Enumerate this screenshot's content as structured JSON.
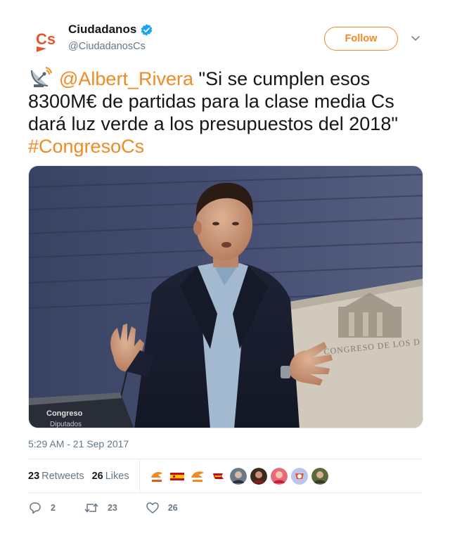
{
  "account": {
    "name": "Ciudadanos",
    "handle": "@CiudadanosCs",
    "logo_text": "Cs",
    "verified": true,
    "brand_color": "#f08a24"
  },
  "follow_button": {
    "label": "Follow"
  },
  "tweet": {
    "icon": "satellite-antenna-icon",
    "mention": "@Albert_Rivera",
    "text": " \"Si se cumplen esos 8300M€ de partidas para la clase media Cs dará luz verde a los presupuestos del 2018\" ",
    "hashtag": "#CongresoCs",
    "photo": {
      "podium_text_1": "Congreso",
      "podium_text_2": "Diputados",
      "wall_text": "CONGRESO DE LOS D"
    },
    "timestamp": "5:29 AM - 21 Sep 2017"
  },
  "stats": {
    "retweets_count": "23",
    "retweets_label": "Retweets",
    "likes_count": "26",
    "likes_label": "Likes"
  },
  "actions": {
    "reply_count": "2",
    "retweet_count": "23",
    "like_count": "26"
  }
}
